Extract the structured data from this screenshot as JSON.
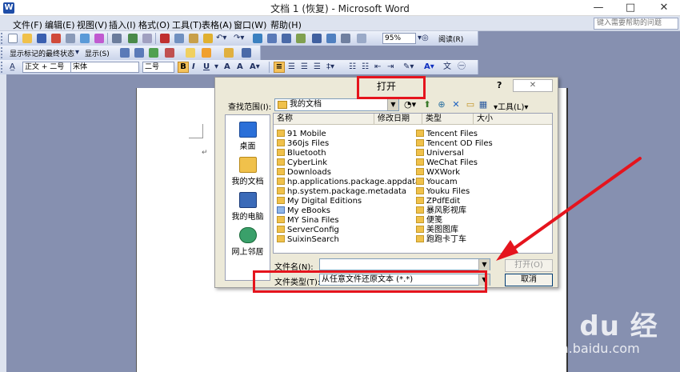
{
  "window": {
    "title": "文档 1 (恢复) - Microsoft Word",
    "app_icon_letter": "W",
    "btn_minimize": "—",
    "btn_maximize": "□",
    "btn_close": "✕"
  },
  "menubar": {
    "items": [
      "文件(F)",
      "编辑(E)",
      "视图(V)",
      "插入(I)",
      "格式(O)",
      "工具(T)",
      "表格(A)",
      "窗口(W)",
      "帮助(H)"
    ],
    "help_placeholder": "键入需要帮助的问题"
  },
  "toolbar1": {
    "zoom": "95%",
    "read_label": "阅读(R)"
  },
  "toolbar2": {
    "markup_view": "显示标记的最终状态",
    "show_label": "显示(S)"
  },
  "toolbar3": {
    "style": "正文 + 二号",
    "font": "宋体",
    "size": "二号"
  },
  "dialog": {
    "title": "打开",
    "help_glyph": "?",
    "close_glyph": "✕",
    "lookin_label": "查找范围(I):",
    "lookin_value": "我的文档",
    "tools_label": "▾工具(L)▾",
    "places": [
      "桌面",
      "我的文档",
      "我的电脑",
      "网上邻居"
    ],
    "columns": [
      "名称",
      "修改日期",
      "类型",
      "大小"
    ],
    "files_col1": [
      "91 Mobile",
      "360js Files",
      "Bluetooth",
      "CyberLink",
      "Downloads",
      "hp.applications.package.appdata",
      "hp.system.package.metadata",
      "My Digital Editions",
      "My eBooks",
      "MY Sina Files",
      "ServerConfig",
      "SuixinSearch"
    ],
    "files_col2": [
      "Tencent Files",
      "Tencent OD Files",
      "Universal",
      "WeChat Files",
      "WXWork",
      "Youcam",
      "Youku Files",
      "ZPdfEdit",
      "暴风影视库",
      "便笺",
      "美图图库",
      "跑跑卡丁车"
    ],
    "filename_label": "文件名(N):",
    "filetype_label": "文件类型(T):",
    "filetype_value": "从任意文件还原文本 (*.*)",
    "open_button": "打开(O)",
    "cancel_button": "取消"
  },
  "watermark": {
    "logo": "Bai du 经验",
    "url": "jingyan.baidu.com"
  },
  "colors": {
    "annotation_red": "#e5141d",
    "desktop_bg": "#8690b0"
  }
}
